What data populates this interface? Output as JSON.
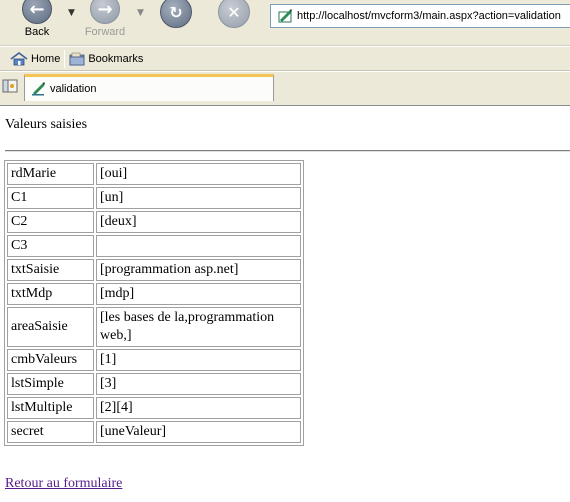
{
  "toolbar": {
    "back_label": "Back",
    "forward_label": "Forward",
    "url": "http://localhost/mvcform3/main.aspx?action=validation"
  },
  "bookmarks": {
    "home_label": "Home",
    "bookmarks_label": "Bookmarks"
  },
  "tab": {
    "label": "validation"
  },
  "page": {
    "title": "Valeurs saisies",
    "rows": [
      {
        "key": "rdMarie",
        "value": "[oui]"
      },
      {
        "key": "C1",
        "value": "[un]"
      },
      {
        "key": "C2",
        "value": "[deux]"
      },
      {
        "key": "C3",
        "value": ""
      },
      {
        "key": "txtSaisie",
        "value": "[programmation asp.net]"
      },
      {
        "key": "txtMdp",
        "value": "[mdp]"
      },
      {
        "key": "areaSaisie",
        "value": "[les bases de la,programmation web,]"
      },
      {
        "key": "cmbValeurs",
        "value": "[1]"
      },
      {
        "key": "lstSimple",
        "value": "[3]"
      },
      {
        "key": "lstMultiple",
        "value": "[2][4]"
      },
      {
        "key": "secret",
        "value": "[uneValeur]"
      }
    ],
    "back_link": "Retour au formulaire"
  }
}
